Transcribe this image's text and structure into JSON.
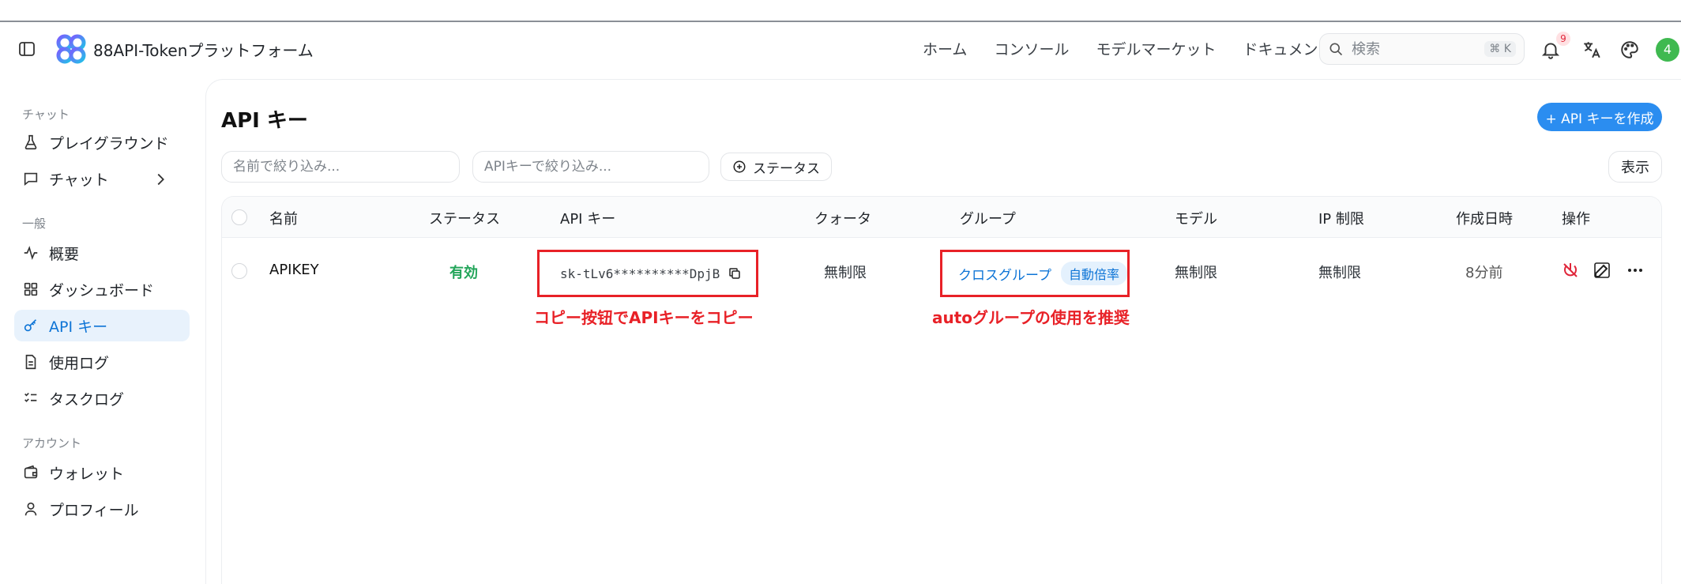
{
  "header": {
    "brand": "88API-Tokenプラットフォーム",
    "nav": [
      "ホーム",
      "コンソール",
      "モデルマーケット",
      "ドキュメント"
    ],
    "search_placeholder": "検索",
    "search_shortcut": "⌘ K",
    "notification_count": "9",
    "avatar_initial": "4"
  },
  "sidebar": {
    "sections": [
      {
        "title": "チャット",
        "items": [
          "プレイグラウンド",
          "チャット"
        ]
      },
      {
        "title": "一般",
        "items": [
          "概要",
          "ダッシュボード",
          "API キー",
          "使用ログ",
          "タスクログ"
        ]
      },
      {
        "title": "アカウント",
        "items": [
          "ウォレット",
          "プロフィール"
        ]
      }
    ],
    "active_item": "API キー"
  },
  "main": {
    "title": "API キー",
    "create_button": "+ API キーを作成",
    "filter_name_placeholder": "名前で絞り込み...",
    "filter_key_placeholder": "APIキーで絞り込み...",
    "status_filter": "ステータス",
    "view_button": "表示",
    "table": {
      "headers": [
        "名前",
        "ステータス",
        "API キー",
        "クォータ",
        "グループ",
        "モデル",
        "IP 制限",
        "作成日時",
        "操作"
      ],
      "rows": [
        {
          "name": "APIKEY",
          "status": "有効",
          "api_key": "sk-tLv6**********DpjB",
          "quota": "無制限",
          "group": "クロスグループ",
          "group_tag": "自動倍率",
          "model": "無制限",
          "ip_limit": "無制限",
          "created": "8分前"
        }
      ]
    },
    "annotations": {
      "copy_hint": "コピー按钮でAPIキーをコピー",
      "group_hint": "autoグループの使用を推奨"
    }
  },
  "colors": {
    "accent": "#2b8df0",
    "status_green": "#23a55a",
    "annotation_red": "#e82127"
  }
}
